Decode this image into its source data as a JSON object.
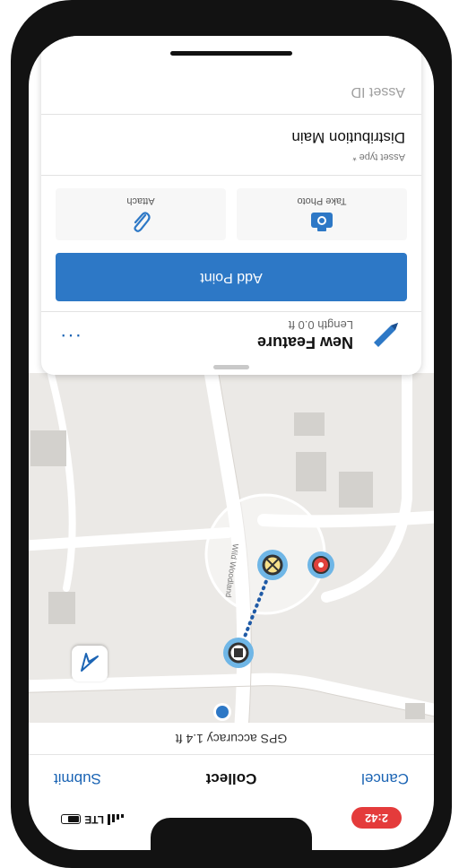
{
  "status_bar": {
    "time": "2:42",
    "network": "LTE"
  },
  "nav": {
    "cancel_label": "Cancel",
    "title": "Collect",
    "submit_label": "Submit"
  },
  "gps": {
    "accuracy_text": "GPS accuracy 1.4 ft"
  },
  "map": {
    "street_label": "Wild Woodland",
    "accent_color": "#2d78c6",
    "icons": [
      "locate-arrow-icon",
      "valve-icon",
      "hydrant-icon",
      "fitting-icon",
      "location-dot-icon"
    ]
  },
  "feature": {
    "name": "New Feature",
    "length": "Length 0.0 ft",
    "more": "···"
  },
  "actions": {
    "add_point_label": "Add Point",
    "take_photo_label": "Take Photo",
    "attach_label": "Attach"
  },
  "form": {
    "asset_type_label": "Asset type *",
    "asset_type_value": "Distribution Main",
    "asset_id_placeholder": "Asset ID"
  }
}
